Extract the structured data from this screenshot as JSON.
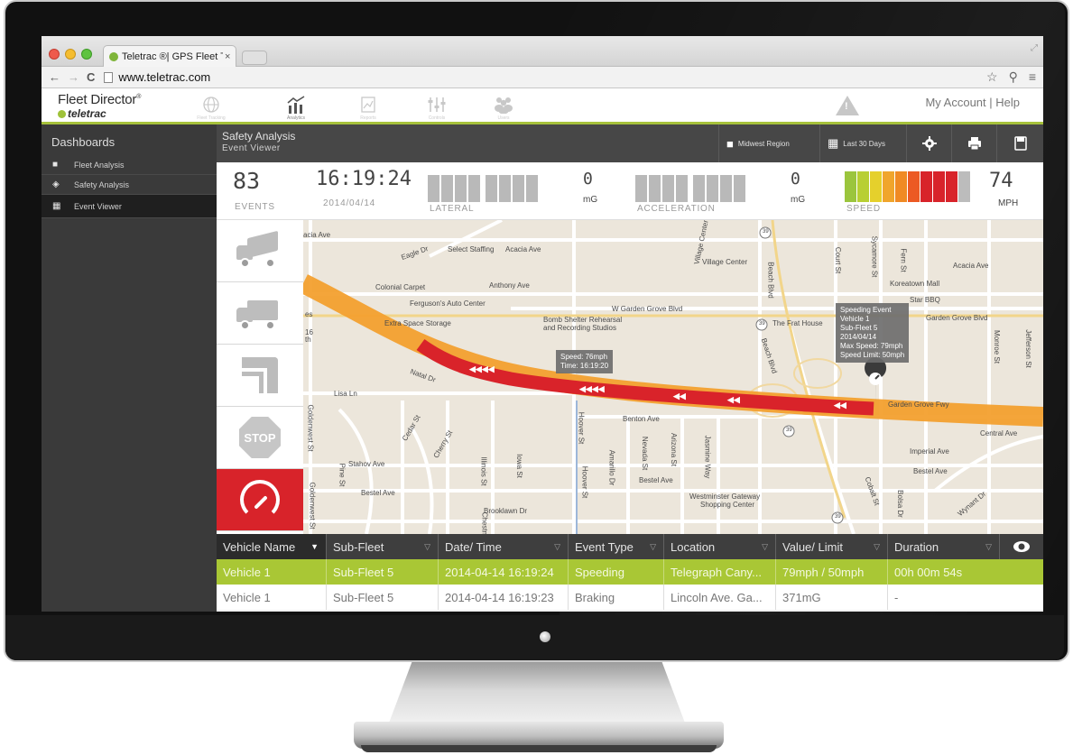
{
  "browser": {
    "tab_title": "Teletrac ®| GPS Fleet Trac",
    "tab_close": "×",
    "url": "www.teletrac.com",
    "nav_back": "←",
    "nav_forward": "→",
    "nav_reload": "C",
    "star": "☆",
    "ext": "⚲",
    "menu": "≡"
  },
  "app": {
    "brand_name": "Fleet Director",
    "brand_mark": "®",
    "brand_sub": "teletrac",
    "nav": [
      {
        "icon": "globe-icon",
        "label": "Fleet Tracking"
      },
      {
        "icon": "analytics-icon",
        "label": "Analytics"
      },
      {
        "icon": "reports-icon",
        "label": "Reports"
      },
      {
        "icon": "controls-icon",
        "label": "Controls"
      },
      {
        "icon": "users-icon",
        "label": "Users"
      }
    ],
    "alert_mark": "!",
    "account_text": "My Account | Help"
  },
  "sidebar": {
    "title": "Dashboards",
    "items": [
      {
        "label": "Fleet Analysis",
        "icon": "truck-icon",
        "glyph": "■",
        "active": false
      },
      {
        "label": "Safety Analysis",
        "icon": "shield-icon",
        "glyph": "◈",
        "active": false
      },
      {
        "label": "Event Viewer",
        "icon": "calendar-icon",
        "glyph": "▦",
        "active": true
      }
    ]
  },
  "content": {
    "title": "Safety Analysis",
    "subtitle": "Event Viewer",
    "region_label": "Midwest Region",
    "period_label": "Last 30 Days"
  },
  "stats": {
    "events_value": "83",
    "events_label": "EVENTS",
    "time_value": "16:19:24",
    "date_value": "2014/04/14",
    "lateral_label": "LATERAL",
    "lateral_value": "0",
    "lateral_unit": "mG",
    "accel_label": "ACCELERATION",
    "accel_value": "0",
    "accel_unit": "mG",
    "speed_label": "SPEED",
    "speed_value": "74",
    "speed_unit": "MPH",
    "speed_bar_colors": [
      "#9bc53d",
      "#b8cf34",
      "#e5d02c",
      "#f0a52c",
      "#f08a24",
      "#ec5a23",
      "#d8232a",
      "#d8232a",
      "#d8232a",
      "#bcbcbc"
    ]
  },
  "map": {
    "labels": {
      "acacia_ave_w": "acia Ave",
      "eagle_dr": "Eagle Dr",
      "select_staffing": "Select Staffing",
      "acacia_ave_mid": "Acacia Ave",
      "village_center_dr": "Village Center",
      "village_center": "Village Center",
      "court_st": "Court St",
      "sycamore_st": "Sycamore St",
      "fern_st": "Fern St",
      "acacia_ave_e": "Acacia Ave",
      "colonial_carpet": "Colonial Carpet",
      "anthony_ave": "Anthony Ave",
      "koreatown_mall": "Koreatown Mall",
      "fergusons": "Ferguson's Auto Center",
      "w_garden_grove": "W Garden Grove Blvd",
      "beach_blvd_n": "Beach Blvd",
      "star_bbq": "Star BBQ",
      "es": "es",
      "extra_space": "Extra Space Storage",
      "bomb_shelter": "Bomb Shelter Rehearsal",
      "bomb_shelter_2": "and Recording Studios",
      "frat_house": "The Frat House",
      "garden_grove_blvd_e": "Garden Grove Blvd",
      "monroe_st": "Monroe St",
      "jefferson_st": "Jefferson St",
      "natal_dr": "Natal Dr",
      "beach_blvd": "Beach Blvd",
      "lisa_ln": "Lisa Ln",
      "goldenwest_st": "Goldenwest St",
      "benton_ave": "Benton Ave",
      "garden_grove_fwy": "Garden Grove Fwy",
      "central_ave": "Central Ave",
      "hoover_st": "Hoover St",
      "cedar_st": "Cedar St",
      "cherry_st": "Cherry St",
      "nevada_st": "Nevada St",
      "arizona_st": "Arizona St",
      "jasmine_way": "Jasmine Way",
      "imperial_ave": "Imperial Ave",
      "stahov_ave": "Stahov Ave",
      "bestel_ave": "Bestel Ave",
      "amarillo_dr": "Amarillo Dr",
      "illinois_st": "Illinois St",
      "iowa_st": "Iowa St",
      "bestel_ave_mid": "Bestel Ave",
      "bestel_ave_e": "Bestel Ave",
      "pine_st": "Pine St",
      "brooklawn_dr": "Brooklawn Dr",
      "westminster_gateway": "Westminster Gateway",
      "shopping_center": "Shopping Center",
      "cobalt_st": "Cobalt St",
      "bolsa_dr": "Bolsa Dr",
      "wyant_dr": "Wynant Dr",
      "route_39": "39",
      "hoover_st_s": "Hoover St",
      "chestnut": "Chestnu",
      "goldenwest_st_s": "Goldenwest St",
      "th": "th",
      "s16": "16"
    },
    "speed_tooltip": {
      "line1": "Speed: 76mph",
      "line2": "Time: 16:19:20"
    },
    "event_tooltip": {
      "line1": "Speeding Event",
      "line2": "Vehicle 1",
      "line3": "Sub-Fleet 5",
      "line4": "2014/04/14",
      "line5": "Max Speed: 79mph",
      "line6": "Speed Limit: 50mph"
    }
  },
  "table": {
    "columns": [
      {
        "label": "Vehicle Name",
        "caret": "▼"
      },
      {
        "label": "Sub-Fleet",
        "caret": "▽"
      },
      {
        "label": "Date/ Time",
        "caret": "▽"
      },
      {
        "label": "Event Type",
        "caret": "▽"
      },
      {
        "label": "Location",
        "caret": "▽"
      },
      {
        "label": "Value/ Limit",
        "caret": "▽"
      },
      {
        "label": "Duration",
        "caret": "▽"
      }
    ],
    "eye_icon": "●",
    "rows": [
      [
        "Vehicle 1",
        "Sub-Fleet 5",
        "2014-04-14 16:19:24",
        "Speeding",
        "Telegraph Cany...",
        "79mph / 50mph",
        "00h 00m 54s"
      ],
      [
        "Vehicle 1",
        "Sub-Fleet 5",
        "2014-04-14 16:19:23",
        "Braking",
        "Lincoln Ave. Ga...",
        "371mG",
        "-"
      ]
    ]
  }
}
